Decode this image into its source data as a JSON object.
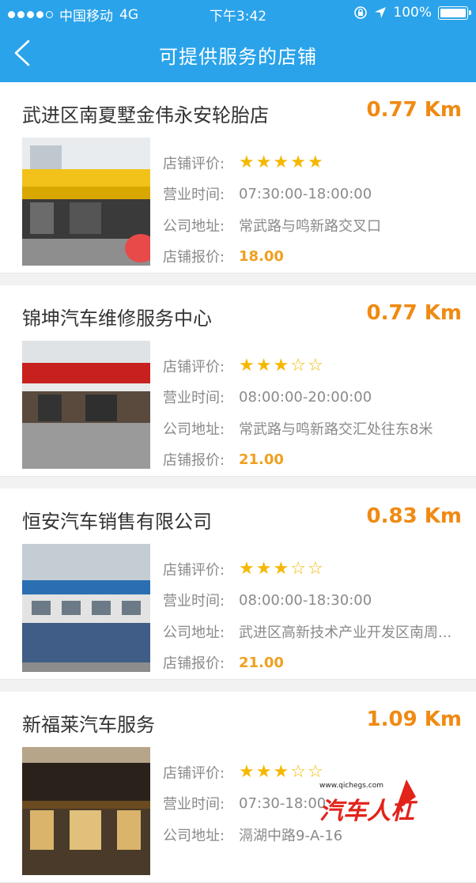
{
  "status_bar": {
    "carrier": "中国移动",
    "network": "4G",
    "time": "下午3:42",
    "battery": "100%"
  },
  "nav": {
    "title": "可提供服务的店铺"
  },
  "labels": {
    "rating": "店铺评价:",
    "hours": "营业时间:",
    "address": "公司地址:",
    "price": "店铺报价:"
  },
  "shops": [
    {
      "name": "武进区南夏墅金伟永安轮胎店",
      "distance": "0.77 Km",
      "rating": 5,
      "hours": "07:30:00-18:00:00",
      "address": "常武路与鸣新路交叉口",
      "price": "18.00"
    },
    {
      "name": "锦坤汽车维修服务中心",
      "distance": "0.77 Km",
      "rating": 3,
      "hours": "08:00:00-20:00:00",
      "address": "常武路与鸣新路交汇处往东8米",
      "price": "21.00"
    },
    {
      "name": "恒安汽车销售有限公司",
      "distance": "0.83 Km",
      "rating": 3,
      "hours": "08:00:00-18:30:00",
      "address": "武进区高新技术产业开发区南周...",
      "price": "21.00"
    },
    {
      "name": "新福莱汽车服务",
      "distance": "1.09 Km",
      "rating": 3,
      "hours": "07:30-18:00",
      "address": "滆湖中路9-A-16",
      "price": ""
    }
  ],
  "watermark": {
    "url": "www.qichegs.com",
    "brand": "汽车人杠"
  },
  "colors": {
    "header": "#2aa3ea",
    "distance": "#f08a12",
    "price": "#f0a020",
    "star": "#f5b800"
  }
}
